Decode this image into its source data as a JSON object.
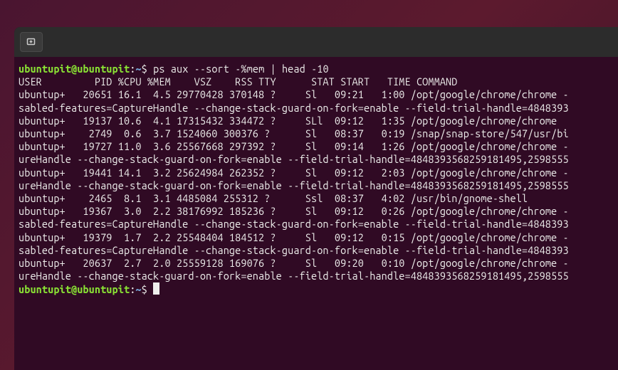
{
  "prompt": {
    "user": "ubuntupit@ubuntupit",
    "path": "~",
    "symbol": "$"
  },
  "command": "ps aux --sort -%mem | head -10",
  "header": "USER         PID %CPU %MEM    VSZ    RSS TTY      STAT START   TIME COMMAND",
  "rows": [
    "ubuntup+   20651 16.1  4.5 29770428 370148 ?     Sl   09:21   1:00 /opt/google/chrome/chrome -",
    "sabled-features=CaptureHandle --change-stack-guard-on-fork=enable --field-trial-handle=4848393",
    "ubuntup+   19137 10.6  4.1 17315432 334472 ?     SLl  09:12   1:35 /opt/google/chrome/chrome",
    "ubuntup+    2749  0.6  3.7 1524060 300376 ?      Sl   08:37   0:19 /snap/snap-store/547/usr/bi",
    "ubuntup+   19727 11.0  3.6 25567668 297392 ?     Sl   09:14   1:26 /opt/google/chrome/chrome -",
    "ureHandle --change-stack-guard-on-fork=enable --field-trial-handle=4848393568259181495,2598555",
    "ubuntup+   19441 14.1  3.2 25624984 262352 ?     Sl   09:12   2:03 /opt/google/chrome/chrome -",
    "ureHandle --change-stack-guard-on-fork=enable --field-trial-handle=4848393568259181495,2598555",
    "ubuntup+    2465  8.1  3.1 4485084 255312 ?      Ssl  08:37   4:02 /usr/bin/gnome-shell",
    "ubuntup+   19367  3.0  2.2 38176992 185236 ?     Sl   09:12   0:26 /opt/google/chrome/chrome -",
    "sabled-features=CaptureHandle --change-stack-guard-on-fork=enable --field-trial-handle=4848393",
    "ubuntup+   19379  1.7  2.2 25548404 184512 ?     Sl   09:12   0:15 /opt/google/chrome/chrome -",
    "sabled-features=CaptureHandle --change-stack-guard-on-fork=enable --field-trial-handle=4848393",
    "ubuntup+   20637  2.7  2.0 25559128 169076 ?     Sl   09:20   0:10 /opt/google/chrome/chrome -",
    "ureHandle --change-stack-guard-on-fork=enable --field-trial-handle=4848393568259181495,2598555"
  ]
}
